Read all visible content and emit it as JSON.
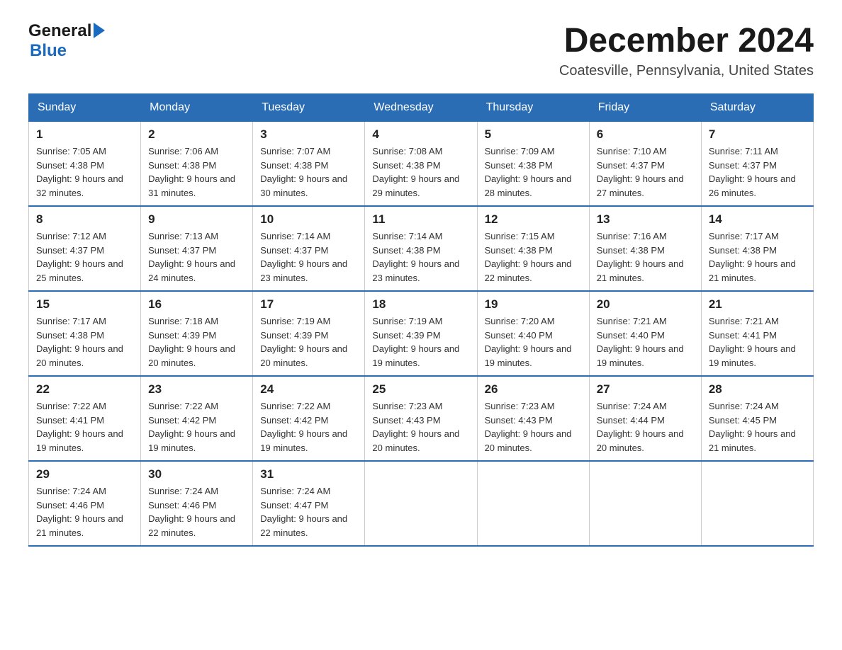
{
  "header": {
    "logo_general": "General",
    "logo_blue": "Blue",
    "title": "December 2024",
    "subtitle": "Coatesville, Pennsylvania, United States"
  },
  "calendar": {
    "days_of_week": [
      "Sunday",
      "Monday",
      "Tuesday",
      "Wednesday",
      "Thursday",
      "Friday",
      "Saturday"
    ],
    "weeks": [
      [
        {
          "date": "1",
          "sunrise": "7:05 AM",
          "sunset": "4:38 PM",
          "daylight": "9 hours and 32 minutes."
        },
        {
          "date": "2",
          "sunrise": "7:06 AM",
          "sunset": "4:38 PM",
          "daylight": "9 hours and 31 minutes."
        },
        {
          "date": "3",
          "sunrise": "7:07 AM",
          "sunset": "4:38 PM",
          "daylight": "9 hours and 30 minutes."
        },
        {
          "date": "4",
          "sunrise": "7:08 AM",
          "sunset": "4:38 PM",
          "daylight": "9 hours and 29 minutes."
        },
        {
          "date": "5",
          "sunrise": "7:09 AM",
          "sunset": "4:38 PM",
          "daylight": "9 hours and 28 minutes."
        },
        {
          "date": "6",
          "sunrise": "7:10 AM",
          "sunset": "4:37 PM",
          "daylight": "9 hours and 27 minutes."
        },
        {
          "date": "7",
          "sunrise": "7:11 AM",
          "sunset": "4:37 PM",
          "daylight": "9 hours and 26 minutes."
        }
      ],
      [
        {
          "date": "8",
          "sunrise": "7:12 AM",
          "sunset": "4:37 PM",
          "daylight": "9 hours and 25 minutes."
        },
        {
          "date": "9",
          "sunrise": "7:13 AM",
          "sunset": "4:37 PM",
          "daylight": "9 hours and 24 minutes."
        },
        {
          "date": "10",
          "sunrise": "7:14 AM",
          "sunset": "4:37 PM",
          "daylight": "9 hours and 23 minutes."
        },
        {
          "date": "11",
          "sunrise": "7:14 AM",
          "sunset": "4:38 PM",
          "daylight": "9 hours and 23 minutes."
        },
        {
          "date": "12",
          "sunrise": "7:15 AM",
          "sunset": "4:38 PM",
          "daylight": "9 hours and 22 minutes."
        },
        {
          "date": "13",
          "sunrise": "7:16 AM",
          "sunset": "4:38 PM",
          "daylight": "9 hours and 21 minutes."
        },
        {
          "date": "14",
          "sunrise": "7:17 AM",
          "sunset": "4:38 PM",
          "daylight": "9 hours and 21 minutes."
        }
      ],
      [
        {
          "date": "15",
          "sunrise": "7:17 AM",
          "sunset": "4:38 PM",
          "daylight": "9 hours and 20 minutes."
        },
        {
          "date": "16",
          "sunrise": "7:18 AM",
          "sunset": "4:39 PM",
          "daylight": "9 hours and 20 minutes."
        },
        {
          "date": "17",
          "sunrise": "7:19 AM",
          "sunset": "4:39 PM",
          "daylight": "9 hours and 20 minutes."
        },
        {
          "date": "18",
          "sunrise": "7:19 AM",
          "sunset": "4:39 PM",
          "daylight": "9 hours and 19 minutes."
        },
        {
          "date": "19",
          "sunrise": "7:20 AM",
          "sunset": "4:40 PM",
          "daylight": "9 hours and 19 minutes."
        },
        {
          "date": "20",
          "sunrise": "7:21 AM",
          "sunset": "4:40 PM",
          "daylight": "9 hours and 19 minutes."
        },
        {
          "date": "21",
          "sunrise": "7:21 AM",
          "sunset": "4:41 PM",
          "daylight": "9 hours and 19 minutes."
        }
      ],
      [
        {
          "date": "22",
          "sunrise": "7:22 AM",
          "sunset": "4:41 PM",
          "daylight": "9 hours and 19 minutes."
        },
        {
          "date": "23",
          "sunrise": "7:22 AM",
          "sunset": "4:42 PM",
          "daylight": "9 hours and 19 minutes."
        },
        {
          "date": "24",
          "sunrise": "7:22 AM",
          "sunset": "4:42 PM",
          "daylight": "9 hours and 19 minutes."
        },
        {
          "date": "25",
          "sunrise": "7:23 AM",
          "sunset": "4:43 PM",
          "daylight": "9 hours and 20 minutes."
        },
        {
          "date": "26",
          "sunrise": "7:23 AM",
          "sunset": "4:43 PM",
          "daylight": "9 hours and 20 minutes."
        },
        {
          "date": "27",
          "sunrise": "7:24 AM",
          "sunset": "4:44 PM",
          "daylight": "9 hours and 20 minutes."
        },
        {
          "date": "28",
          "sunrise": "7:24 AM",
          "sunset": "4:45 PM",
          "daylight": "9 hours and 21 minutes."
        }
      ],
      [
        {
          "date": "29",
          "sunrise": "7:24 AM",
          "sunset": "4:46 PM",
          "daylight": "9 hours and 21 minutes."
        },
        {
          "date": "30",
          "sunrise": "7:24 AM",
          "sunset": "4:46 PM",
          "daylight": "9 hours and 22 minutes."
        },
        {
          "date": "31",
          "sunrise": "7:24 AM",
          "sunset": "4:47 PM",
          "daylight": "9 hours and 22 minutes."
        },
        null,
        null,
        null,
        null
      ]
    ]
  }
}
